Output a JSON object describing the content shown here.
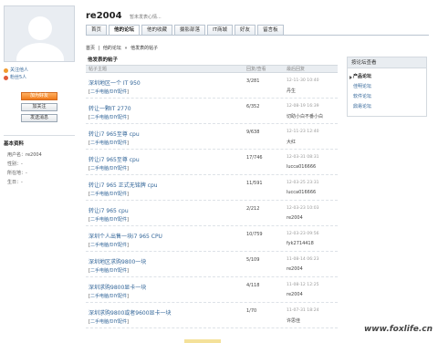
{
  "header": {
    "username": "re2004",
    "signature": "暂未发表心情..."
  },
  "tabs": [
    {
      "label": "首页",
      "active": false
    },
    {
      "label": "他的论坛",
      "active": true
    },
    {
      "label": "他的收藏",
      "active": false
    },
    {
      "label": "摄影部落",
      "active": false
    },
    {
      "label": "IT商城",
      "active": false
    },
    {
      "label": "好友",
      "active": false
    },
    {
      "label": "留言板",
      "active": false
    }
  ],
  "breadcrumb": {
    "home": "首页",
    "sep": "|",
    "forum": "他的论坛",
    "arrow": "»",
    "current": "他发表的帖子"
  },
  "sidebar": {
    "fans_label": "关注他人",
    "follows_label": "粉丝5人",
    "buttons": [
      "加为好友",
      "加关注",
      "发送消息"
    ],
    "basic_title": "基本资料",
    "fields": [
      {
        "label": "用户名",
        "value": "re2004"
      },
      {
        "label": "性别",
        "value": "-"
      },
      {
        "label": "所在地",
        "value": "-"
      },
      {
        "label": "生日",
        "value": "-"
      }
    ]
  },
  "main": {
    "title": "他发表的帖子",
    "columns": {
      "title": "帖子主题",
      "views": "回复/查看",
      "last": "最后回复"
    },
    "rows": [
      {
        "title": "深圳地区一个 IT 950",
        "forum": "二手电脑/DIY配件",
        "views": "3/281",
        "date": "12-11-30 10:40",
        "user": "丹生"
      },
      {
        "title": "转让一颗IT 2770",
        "forum": "二手电脑/DIY配件",
        "views": "6/352",
        "date": "12-08-19 16:39",
        "user": "切助小白不番小白"
      },
      {
        "title": "转让i7 965至尊 cpu",
        "forum": "二手电脑/DIY配件",
        "views": "9/638",
        "date": "12-11-23 12:40",
        "user": "大红"
      },
      {
        "title": "转让i7 965至尊 cpu",
        "forum": "二手电脑/DIY配件",
        "views": "17/746",
        "date": "12-03-31 08:31",
        "user": "lucca016666"
      },
      {
        "title": "转让i7 965 正式无铭牌 cpu",
        "forum": "二手电脑/DIY配件",
        "views": "11/591",
        "date": "12-03-25 23:31",
        "user": "lucca016666"
      },
      {
        "title": "转让i7 965 cpu",
        "forum": "二手电脑/DIY配件",
        "views": "2/212",
        "date": "12-03-23 10:03",
        "user": "re2004"
      },
      {
        "title": "深圳个人出售一块i7 965 CPU",
        "forum": "二手电脑/DIY配件",
        "views": "10/759",
        "date": "12-03-23 09:56",
        "user": "fyk2714418"
      },
      {
        "title": "深圳地区求购9800一块",
        "forum": "二手电脑/DIY配件",
        "views": "5/109",
        "date": "11-08-14 06:23",
        "user": "re2004"
      },
      {
        "title": "深圳求购9800显卡一块",
        "forum": "二手电脑/DIY配件",
        "views": "4/118",
        "date": "11-08-12 12:25",
        "user": "re2004"
      },
      {
        "title": "深圳求购9800或者9600显卡一块",
        "forum": "二手电脑/DIY配件",
        "views": "1/70",
        "date": "11-07-31 18:24",
        "user": "许思佳"
      }
    ]
  },
  "right_box": {
    "title": "按论坛查看",
    "items": [
      {
        "label": "产品论坛",
        "active": true
      },
      {
        "label": "佳明论坛",
        "active": false
      },
      {
        "label": "软件论坛",
        "active": false
      },
      {
        "label": "鼎易论坛",
        "active": false
      }
    ]
  },
  "watermark": "www.foxlife.cn",
  "colors": {
    "link": "#336699",
    "accent": "#f07a1a",
    "tab_border": "#b9c4d0"
  }
}
